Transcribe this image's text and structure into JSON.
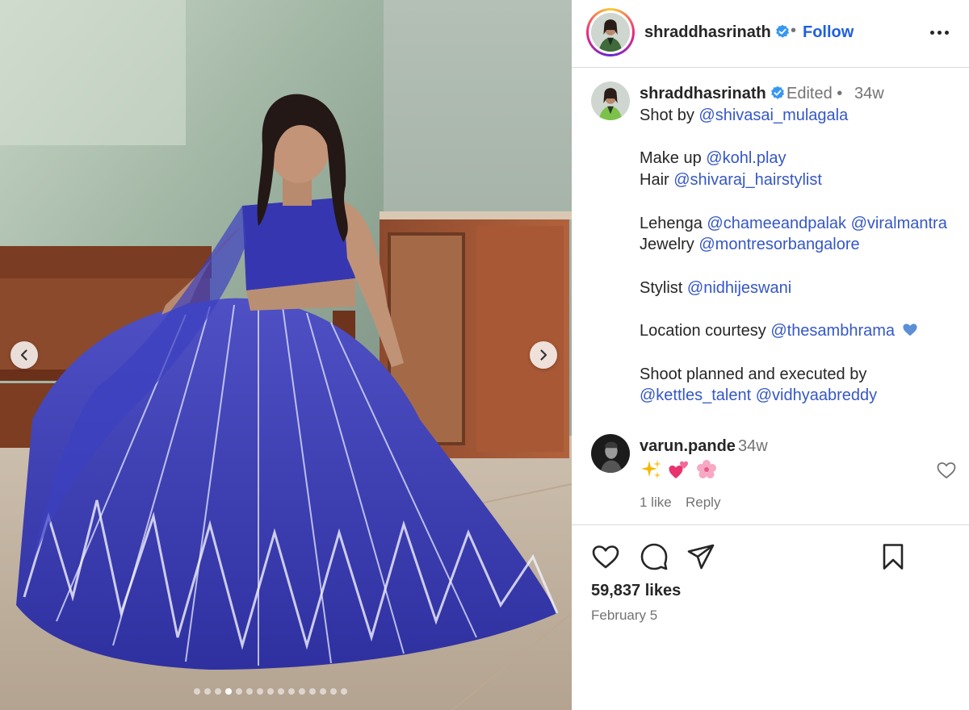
{
  "post": {
    "username": "shraddhasrinath",
    "follow_label": "Follow",
    "separator": "•",
    "edited_label": "Edited",
    "age": "34w",
    "likes": "59,837 likes",
    "date": "February 5",
    "carousel": {
      "total_slides": 15,
      "current_slide": 4
    }
  },
  "caption": {
    "shot_by": {
      "text": "Shot by ",
      "mention": "@shivasai_mulagala"
    },
    "makeup": {
      "text": "Make up ",
      "mention": "@kohl.play"
    },
    "hair": {
      "text": "Hair ",
      "mention": "@shivaraj_hairstylist"
    },
    "lehenga": {
      "text": "Lehenga ",
      "mention1": "@chameeandpalak",
      "mention2": "@viralmantra"
    },
    "jewelry": {
      "text": "Jewelry ",
      "mention": "@montresorbangalore"
    },
    "stylist": {
      "text": "Stylist ",
      "mention": "@nidhijeswani"
    },
    "location": {
      "text": "Location courtesy ",
      "mention": "@thesambhrama"
    },
    "shoot": {
      "text": "Shoot planned and executed by",
      "mention1": "@kettles_talent",
      "mention2": "@vidhyaabreddy"
    }
  },
  "comment": {
    "username": "varun.pande",
    "age": "34w",
    "emojis": [
      "sparkles",
      "two-hearts",
      "cherry-blossom"
    ],
    "likes": "1 like",
    "reply_label": "Reply"
  },
  "icons": {
    "verified": "verified-badge-icon",
    "more": "more-options-icon",
    "prev": "chevron-left-icon",
    "next": "chevron-right-icon",
    "like": "heart-outline-icon",
    "comment": "comment-bubble-icon",
    "share": "paper-plane-icon",
    "save": "bookmark-icon",
    "blue_heart": "blue-heart-icon"
  },
  "colors": {
    "link": "#3557c7",
    "follow": "#1f5fe0",
    "muted": "#737373",
    "verified": "#3897f0",
    "divider": "#dbdbdb"
  }
}
